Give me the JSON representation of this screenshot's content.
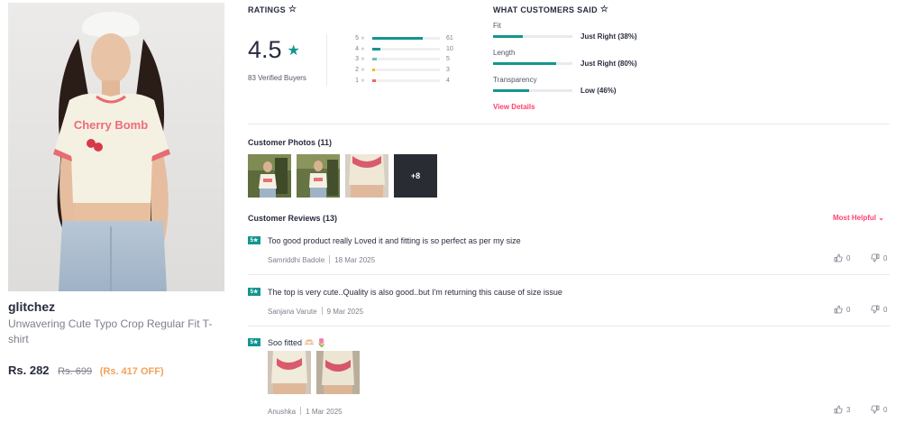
{
  "product": {
    "brand": "glitchez",
    "name": "Unwavering Cute Typo Crop Regular Fit T-shirt",
    "price": "Rs. 282",
    "mrp": "Rs. 699",
    "discount": "(Rs. 417 OFF)",
    "print_text": "Cherry Bomb"
  },
  "ratings": {
    "title": "RATINGS",
    "average": "4.5",
    "verified": "83 Verified Buyers",
    "distribution": [
      {
        "stars": "5",
        "count": "61",
        "share": 0.75,
        "color": "#14958f"
      },
      {
        "stars": "4",
        "count": "10",
        "share": 0.12,
        "color": "#14958f"
      },
      {
        "stars": "3",
        "count": "5",
        "share": 0.06,
        "color": "#72bfbc"
      },
      {
        "stars": "2",
        "count": "3",
        "share": 0.04,
        "color": "#fcb301"
      },
      {
        "stars": "1",
        "count": "4",
        "share": 0.05,
        "color": "#f16565"
      }
    ]
  },
  "customers_said": {
    "title": "WHAT CUSTOMERS SAID",
    "attributes": [
      {
        "label": "Fit",
        "value": "Just Right (38%)",
        "percent": 38
      },
      {
        "label": "Length",
        "value": "Just Right (80%)",
        "percent": 80
      },
      {
        "label": "Transparency",
        "value": "Low (46%)",
        "percent": 46
      }
    ],
    "view_details": "View Details"
  },
  "photos": {
    "title": "Customer Photos (11)",
    "more": "+8"
  },
  "reviews": {
    "title": "Customer Reviews (13)",
    "sort": "Most Helpful",
    "items": [
      {
        "rating": "5★",
        "text": "Too good product really Loved it and fitting is so perfect as per my size",
        "author": "Samriddhi Badole",
        "date": "18 Mar 2025",
        "up": "0",
        "down": "0"
      },
      {
        "rating": "5★",
        "text": "The top is very cute..Quality is also good..but I'm returning this cause of size issue",
        "author": "Sanjana Varute",
        "date": "9 Mar 2025",
        "up": "0",
        "down": "0"
      },
      {
        "rating": "5★",
        "text": "Soo fitted 🫶🏻 🌷",
        "author": "Anushka",
        "date": "1 Mar 2025",
        "up": "3",
        "down": "0"
      }
    ]
  }
}
